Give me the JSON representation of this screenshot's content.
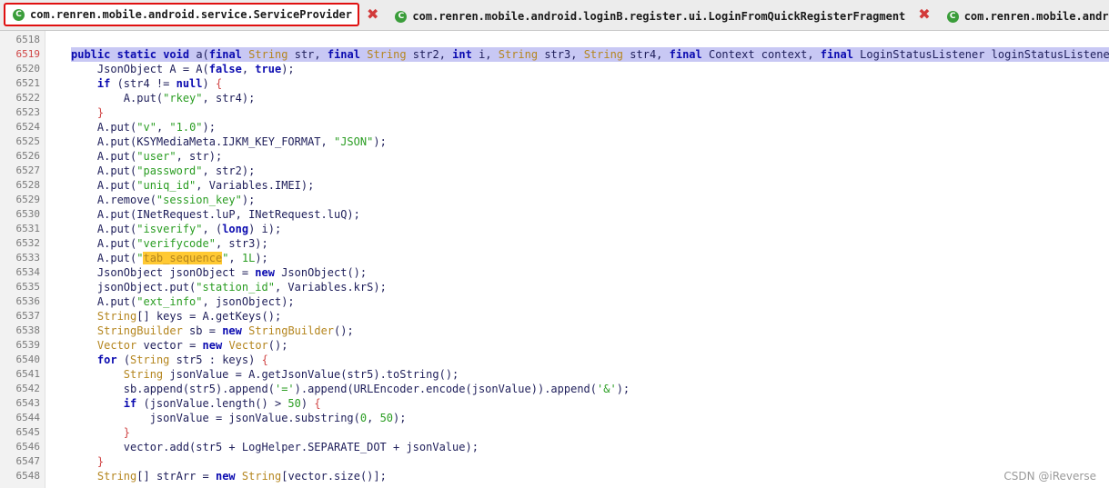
{
  "tabs": [
    {
      "label": "com.renren.mobile.android.service.ServiceProvider",
      "icon": "class-icon"
    },
    {
      "label": "com.renren.mobile.android.loginB.register.ui.LoginFromQuickRegisterFragment",
      "icon": "class-icon"
    },
    {
      "label": "com.renren.mobile.android.lo",
      "icon": "class-icon"
    }
  ],
  "line_numbers": [
    "6518",
    "6519",
    "6520",
    "6521",
    "6522",
    "6523",
    "6524",
    "6525",
    "6526",
    "6527",
    "6528",
    "6529",
    "6530",
    "6531",
    "6532",
    "6533",
    "6534",
    "6535",
    "6536",
    "6537",
    "6538",
    "6539",
    "6540",
    "6541",
    "6542",
    "6543",
    "6544",
    "6545",
    "6546",
    "6547",
    "6548"
  ],
  "highlight_line": "6519",
  "code_lines": [
    "",
    "public static void a(final String str, final String str2, int i, String str3, String str4, final Context context, final LoginStatusListener loginStatusListener) {",
    "    JsonObject A = A(false, true);",
    "    if (str4 != null) {",
    "        A.put(\"rkey\", str4);",
    "    }",
    "    A.put(\"v\", \"1.0\");",
    "    A.put(KSYMediaMeta.IJKM_KEY_FORMAT, \"JSON\");",
    "    A.put(\"user\", str);",
    "    A.put(\"password\", str2);",
    "    A.put(\"uniq_id\", Variables.IMEI);",
    "    A.remove(\"session_key\");",
    "    A.put(INetRequest.luP, INetRequest.luQ);",
    "    A.put(\"isverify\", (long) i);",
    "    A.put(\"verifycode\", str3);",
    "    A.put(\"tab_sequence\", 1L);",
    "    JsonObject jsonObject = new JsonObject();",
    "    jsonObject.put(\"station_id\", Variables.krS);",
    "    A.put(\"ext_info\", jsonObject);",
    "    String[] keys = A.getKeys();",
    "    StringBuilder sb = new StringBuilder();",
    "    Vector vector = new Vector();",
    "    for (String str5 : keys) {",
    "        String jsonValue = A.getJsonValue(str5).toString();",
    "        sb.append(str5).append('=').append(URLEncoder.encode(jsonValue)).append('&');",
    "        if (jsonValue.length() > 50) {",
    "            jsonValue = jsonValue.substring(0, 50);",
    "        }",
    "        vector.add(str5 + LogHelper.SEPARATE_DOT + jsonValue);",
    "    }",
    "    String[] strArr = new String[vector.size()];"
  ],
  "search_highlight": "tab_sequence",
  "watermark": "CSDN @iReverse",
  "colors": {
    "active_tab_border": "#e01010",
    "keyword": "#0b0bb0",
    "type": "#b5861f",
    "string": "#2a9d22",
    "selection": "#c8c8f4",
    "search_highlight": "#ffc933"
  }
}
